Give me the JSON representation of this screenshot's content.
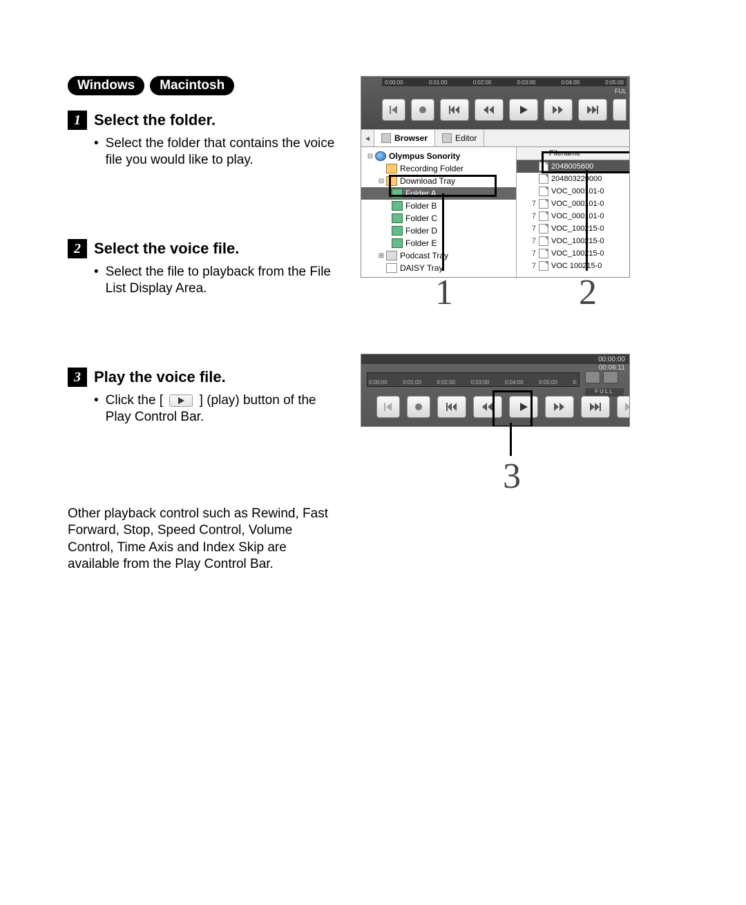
{
  "os": {
    "windows": "Windows",
    "mac": "Macintosh"
  },
  "steps": [
    {
      "num": "1",
      "title": "Select the folder.",
      "bullet": "Select the folder that contains the voice file you would like to play."
    },
    {
      "num": "2",
      "title": "Select the voice file.",
      "bullet": "Select the file to playback from the File List Display Area."
    },
    {
      "num": "3",
      "title": "Play the voice file.",
      "bullet_pre": "Click the [",
      "bullet_post": "] (play) button of the Play Control Bar."
    }
  ],
  "after": "Other playback control such as Rewind, Fast Forward, Stop, Speed Control, Volume Control, Time Axis and Index Skip are available from the Play Control Bar.",
  "timeline_ticks": [
    "0:00:00",
    "0:01:00",
    "0:02:00",
    "0:03:00",
    "0:04:00",
    "0:05:00"
  ],
  "full_label": "FUL",
  "tabs": {
    "browser": "Browser",
    "editor": "Editor"
  },
  "tree": {
    "root": "Olympus Sonority",
    "rec": "Recording Folder",
    "dl": "Download Tray",
    "fa": "Folder A",
    "fb": "Folder B",
    "fc": "Folder C",
    "fd": "Folder D",
    "fe": "Folder E",
    "pod": "Podcast Tray",
    "daisy": "DAISY Tray"
  },
  "filelist": {
    "header": "Filename",
    "rows": [
      {
        "ix": "",
        "name": "2048005600"
      },
      {
        "ix": "",
        "name": "204803220000"
      },
      {
        "ix": "",
        "name": "VOC_000101-0"
      },
      {
        "ix": "7",
        "name": "VOC_000101-0"
      },
      {
        "ix": "7",
        "name": "VOC_000101-0"
      },
      {
        "ix": "7",
        "name": "VOC_100215-0"
      },
      {
        "ix": "7",
        "name": "VOC_100215-0"
      },
      {
        "ix": "7",
        "name": "VOC_100215-0"
      },
      {
        "ix": "7",
        "name": "VOC 100215-0"
      }
    ]
  },
  "scr2": {
    "time_cur": "00:00:00",
    "time_tot": "00:06:11",
    "ruler": [
      "0:00:00",
      "0:01:00",
      "0:02:00",
      "0:03:00",
      "0:04:00",
      "0:05:00",
      "0:"
    ],
    "full": "FULL"
  },
  "callouts": {
    "n1": "1",
    "n2": "2",
    "n3": "3"
  }
}
